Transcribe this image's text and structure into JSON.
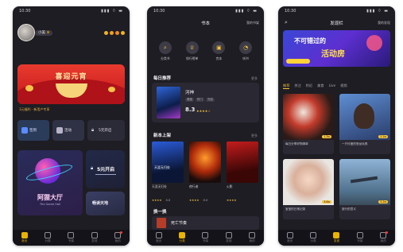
{
  "phone1": {
    "status": {
      "time": "10:30",
      "signal": "▮▮▮ ⌔ ▬"
    },
    "user": {
      "name": "小美"
    },
    "banner": {
      "text": "喜迎元宵"
    },
    "notice_text": "1元福利 · 新用户专享",
    "quick": [
      {
        "label": "签到"
      },
      {
        "label": "活动"
      },
      {
        "label": "5元开启"
      }
    ],
    "cards": {
      "big_title": "阿狸大厅",
      "big_sub": "The Game Hall",
      "r1_title": "5元开启",
      "r2_title": "畅读天地"
    },
    "tabs": [
      "首页",
      "分类",
      "书架",
      "发现",
      "我的"
    ]
  },
  "phone2": {
    "status": {
      "time": "10:30",
      "signal": "▮▮▮ ⌔ ▬"
    },
    "nav": {
      "title": "书本",
      "right": "我的书架"
    },
    "icons": [
      {
        "label": "分类书"
      },
      {
        "label": "排行榜单"
      },
      {
        "label": "完本"
      },
      {
        "label": "听书"
      }
    ],
    "daily": {
      "title": "每日推荐",
      "more": "更多",
      "book_title": "河神",
      "score": "8.3",
      "tags": [
        "悬疑",
        "热门",
        "完结"
      ]
    },
    "newbooks": {
      "title": "新本上架",
      "more": "更多",
      "items": [
        {
          "title": "天涯无归处",
          "score": "8.8"
        },
        {
          "title": "夜行者",
          "score": "8.6"
        },
        {
          "title": "火影"
        }
      ]
    },
    "swap": {
      "title": "换一换",
      "book_title": "死亡节奏"
    },
    "tabs": [
      "首页",
      "分类",
      "书架",
      "发现",
      "我的"
    ]
  },
  "phone3": {
    "status": {
      "time": "10:30",
      "signal": "▮▮▮ ⌔ ▬"
    },
    "nav": {
      "title": "发现栏",
      "right": "我的发现"
    },
    "banner": {
      "line1": "不可错过的",
      "line2": "活动房"
    },
    "chips": [
      "推荐",
      "关注",
      "附近",
      "美食",
      "Live",
      "视频"
    ],
    "cards": [
      {
        "title": "每日分享好物清单",
        "badge": "1.3w"
      },
      {
        "title": "一只可爱的恐龙玩具",
        "badge": "2.1w"
      },
      {
        "title": "宝宝的日常记录",
        "badge": "3.6w"
      },
      {
        "title": "旅行的意义",
        "badge": "5.2w"
      }
    ],
    "tabs": [
      "首页",
      "分类",
      "发现",
      "书架",
      "我的"
    ]
  }
}
